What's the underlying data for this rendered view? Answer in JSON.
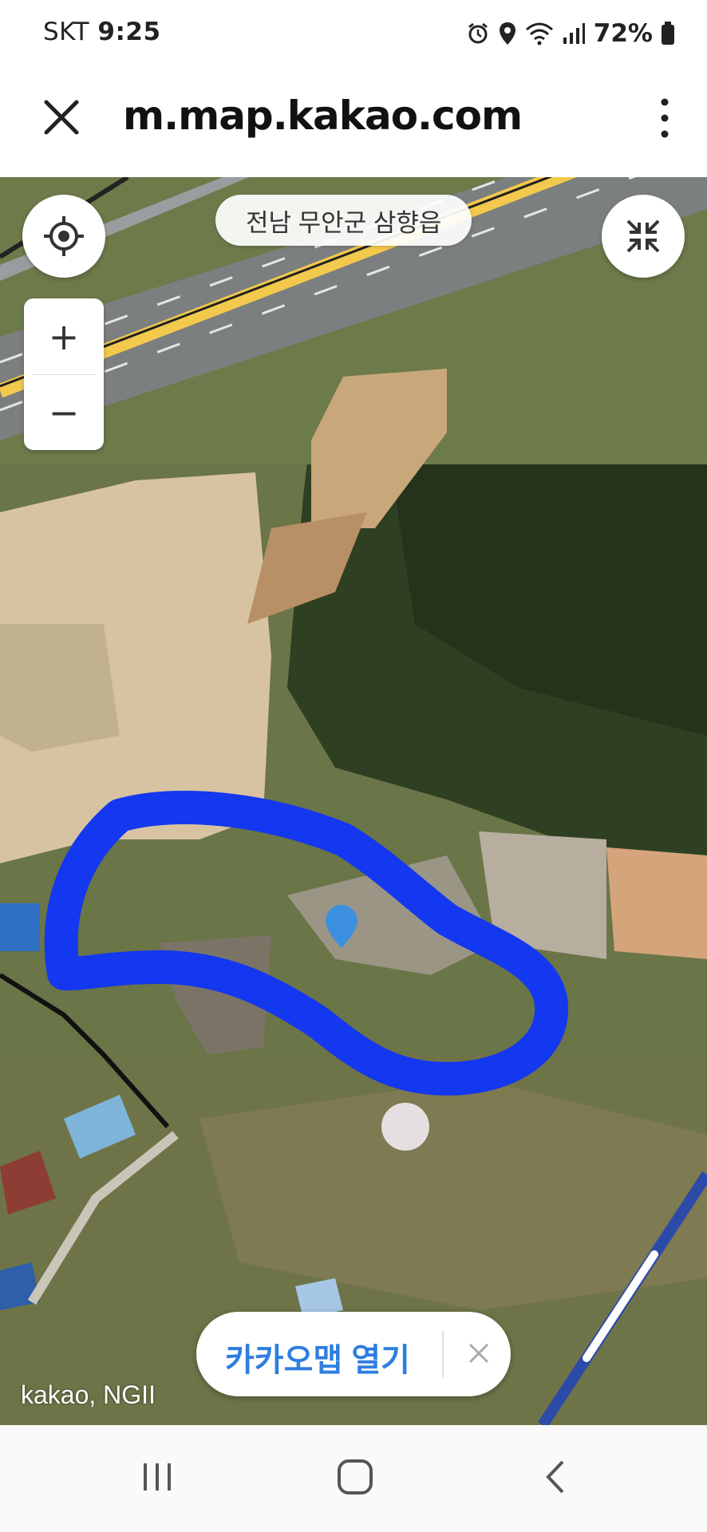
{
  "status_bar": {
    "carrier": "SKT",
    "time": "9:25",
    "battery": "72%",
    "icons": [
      "alarm-icon",
      "location-icon",
      "wifi-icon",
      "signal-icon",
      "battery-icon"
    ]
  },
  "browser": {
    "url": "m.map.kakao.com",
    "close_icon": "close-icon",
    "menu_icon": "more-vert-icon"
  },
  "map": {
    "region_label": "전남 무안군 삼향읍",
    "attribution": "kakao, NGII",
    "zoom_in": "+",
    "zoom_out": "−",
    "location_icon": "my-location-icon",
    "collapse_icon": "collapse-icon",
    "marker_color": "#3d8fe0",
    "drawn_outline_color": "#1437f0"
  },
  "open_app": {
    "label": "카카오맵 열기",
    "dismiss_icon": "close-icon"
  },
  "nav_bar": {
    "recent_icon": "recent-apps-icon",
    "home_icon": "home-icon",
    "back_icon": "back-icon"
  }
}
